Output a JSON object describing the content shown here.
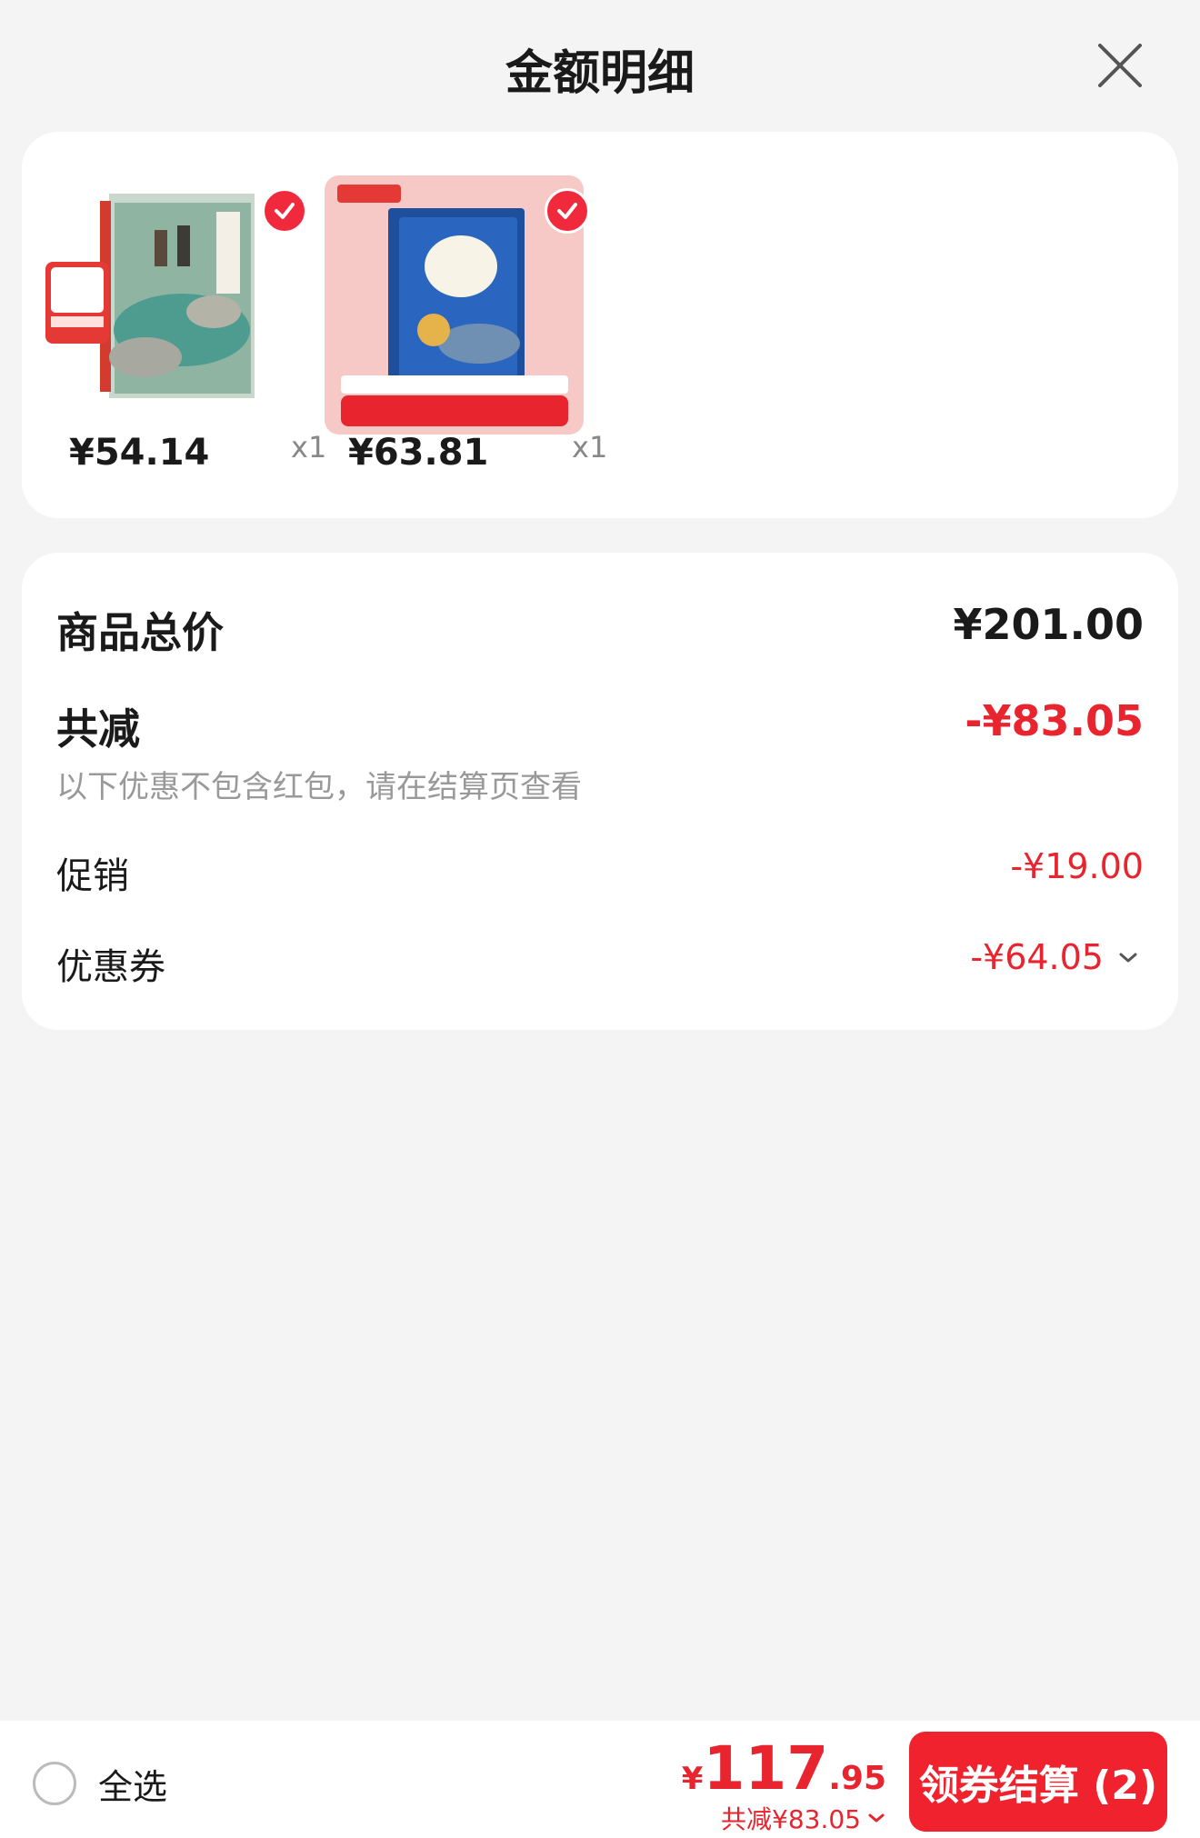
{
  "header": {
    "title": "金额明细"
  },
  "products": [
    {
      "price": "¥54.14",
      "qty": "x1"
    },
    {
      "price": "¥63.81",
      "qty": "x1"
    }
  ],
  "summary": {
    "total_label": "商品总价",
    "total_value": "¥201.00",
    "reduce_label": "共减",
    "reduce_value": "-¥83.05",
    "note": "以下优惠不包含红包，请在结算页查看",
    "promo_label": "促销",
    "promo_value": "-¥19.00",
    "coupon_label": "优惠券",
    "coupon_value": "-¥64.05"
  },
  "bottom": {
    "select_all_label": "全选",
    "currency": "¥",
    "amount_int": "117",
    "amount_dec": ".95",
    "reduce_text": "共减¥83.05",
    "checkout_label": "领券结算 (2)"
  },
  "colors": {
    "accent": "#e8242e",
    "button": "#f0222e",
    "background": "#f4f4f4"
  }
}
